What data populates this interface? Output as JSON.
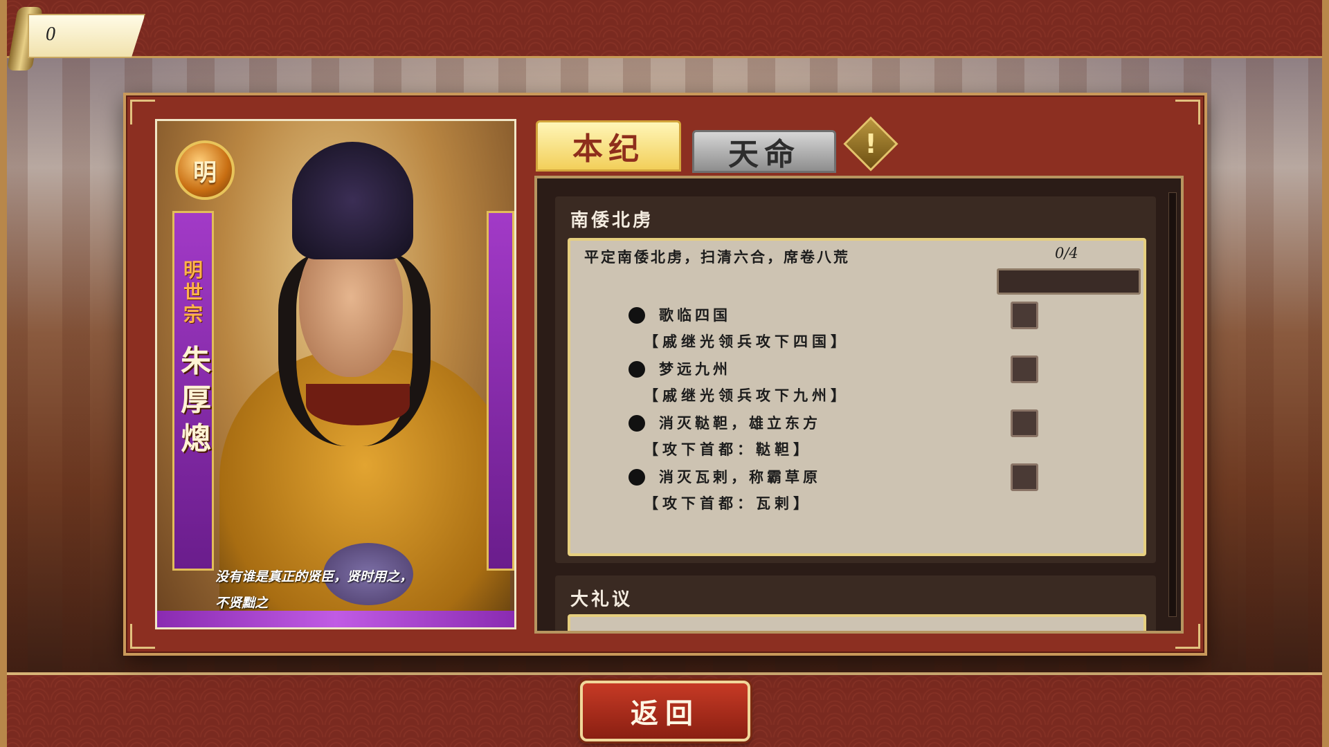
{
  "resources": {
    "value": "0"
  },
  "character": {
    "dynasty_emblem": "明",
    "title": "明世宗",
    "name": "朱厚熜",
    "quote_line1": "没有谁是真正的贤臣，贤时用之，",
    "quote_line2": "不贤黜之"
  },
  "tabs": {
    "active_label": "本纪",
    "inactive_label": "天命",
    "alert_label": "!"
  },
  "quests": [
    {
      "title": "南倭北虏",
      "description": "平定南倭北虏，扫清六合，席卷八荒",
      "progress_text": "0/4",
      "progress_fraction": 0,
      "subquests": [
        {
          "title": "歌临四国",
          "condition": "【戚继光领兵攻下四国】",
          "done": false
        },
        {
          "title": "梦远九州",
          "condition": "【戚继光领兵攻下九州】",
          "done": false
        },
        {
          "title": "消灭鞑靼，雄立东方",
          "condition": "【攻下首都：鞑靼】",
          "done": false
        },
        {
          "title": "消灭瓦剌，称霸草原",
          "condition": "【攻下首都：瓦剌】",
          "done": false
        }
      ]
    },
    {
      "title": "大礼议"
    }
  ],
  "footer": {
    "back_label": "返回"
  },
  "colors": {
    "lacquer_red": "#8c2f21",
    "gold_border": "#c9995a",
    "active_tab": "#f2cf5a",
    "parchment": "#cdc3b2"
  },
  "icons": [
    "scroll-icon",
    "dynasty-emblem-icon",
    "alert-diamond-icon",
    "bullet-icon",
    "checkbox-icon"
  ]
}
